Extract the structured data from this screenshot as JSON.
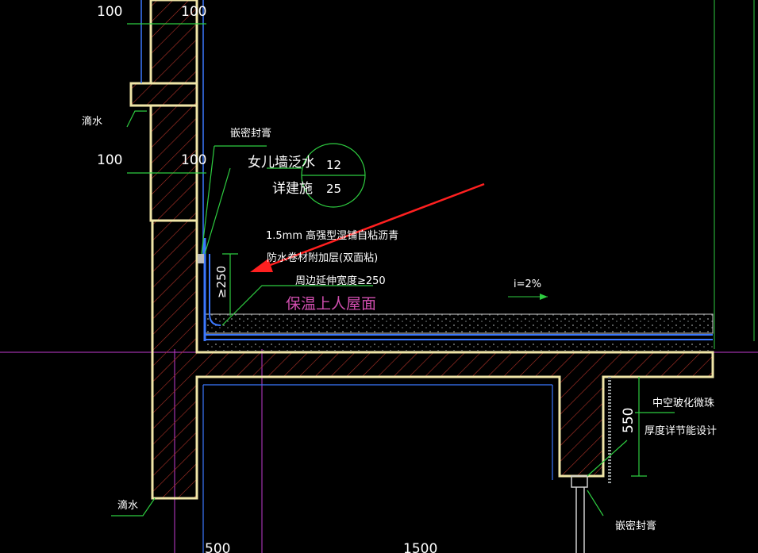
{
  "labels": {
    "dim_top_left": "100",
    "dim_top_right": "100",
    "drip_upper": "滴水",
    "dim_mid_left": "100",
    "dim_mid_right": "100",
    "sealant_upper": "嵌密封膏",
    "parapet_flashing": "女儿墙泛水",
    "see_arch": "详建施",
    "detail_no": "12",
    "sheet_no": "25",
    "membrane_line1": "1.5mm 高强型湿铺自粘沥青",
    "membrane_line2": "防水卷材附加层(双面粘)",
    "membrane_line3": "周边延伸宽度≥250",
    "height_dim": "≥250",
    "slope": "i=2%",
    "roof_type": "保温上人屋面",
    "insulation_line1": "中空玻化微珠",
    "insulation_line2": "厚度详节能设计",
    "dim_550": "550",
    "drip_lower": "滴水",
    "sealant_lower": "嵌密封膏",
    "dim_bottom_left": "500",
    "dim_bottom_right": "1500"
  },
  "colors": {
    "background": "#000000",
    "outline": "#f0e6a8",
    "hatch": "#c0392b",
    "dim_line": "#2ecc40",
    "waterproof": "#3b78ff",
    "guide": "#c23bd0",
    "arrow": "#ff2020",
    "slope_text": "#ffffff",
    "roof_label": "#d24fb0"
  }
}
